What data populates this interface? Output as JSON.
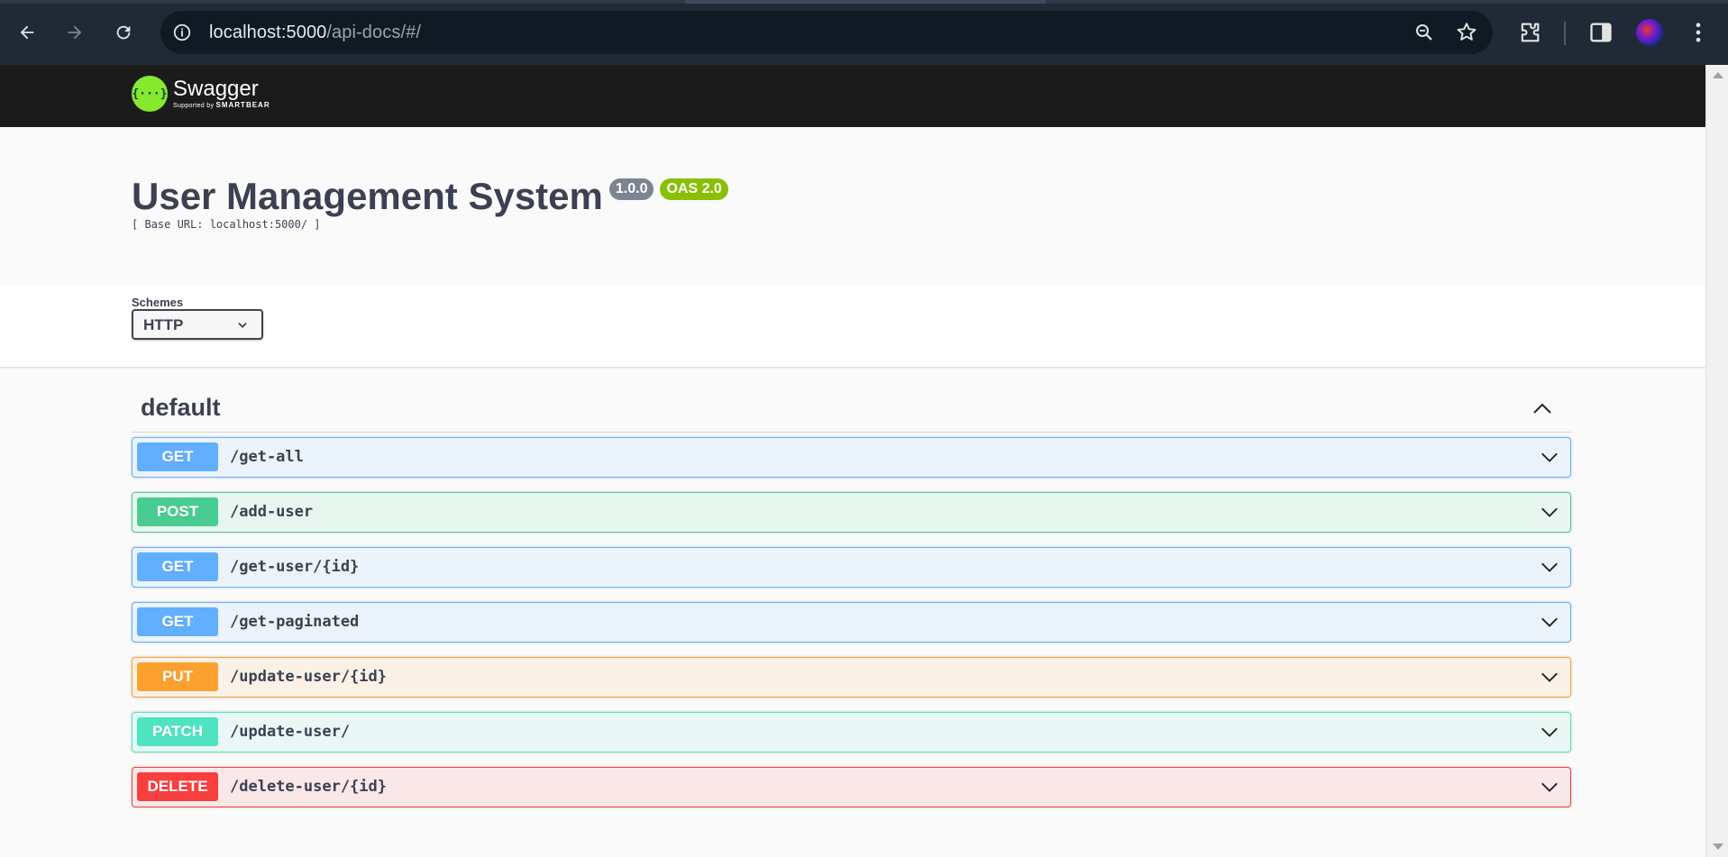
{
  "browser": {
    "url_host": "localhost:5000",
    "url_path": "/api-docs/#/"
  },
  "swagger": {
    "brand": "Swagger",
    "brand_sub_prefix": "Supported by",
    "brand_sub_company": "SMARTBEAR",
    "brand_color": "#85ea2d"
  },
  "info": {
    "title": "User Management System",
    "version": "1.0.0",
    "oas": "OAS 2.0",
    "base_url": "[ Base URL: localhost:5000/ ]"
  },
  "schemes": {
    "label": "Schemes",
    "selected": "HTTP"
  },
  "tag": {
    "name": "default"
  },
  "operations": [
    {
      "method": "GET",
      "path": "/get-all",
      "color": "#61affe"
    },
    {
      "method": "POST",
      "path": "/add-user",
      "color": "#49cc90"
    },
    {
      "method": "GET",
      "path": "/get-user/{id}",
      "color": "#61affe"
    },
    {
      "method": "GET",
      "path": "/get-paginated",
      "color": "#61affe"
    },
    {
      "method": "PUT",
      "path": "/update-user/{id}",
      "color": "#fca130"
    },
    {
      "method": "PATCH",
      "path": "/update-user/",
      "color": "#50e3c2"
    },
    {
      "method": "DELETE",
      "path": "/delete-user/{id}",
      "color": "#f93e3e"
    }
  ]
}
